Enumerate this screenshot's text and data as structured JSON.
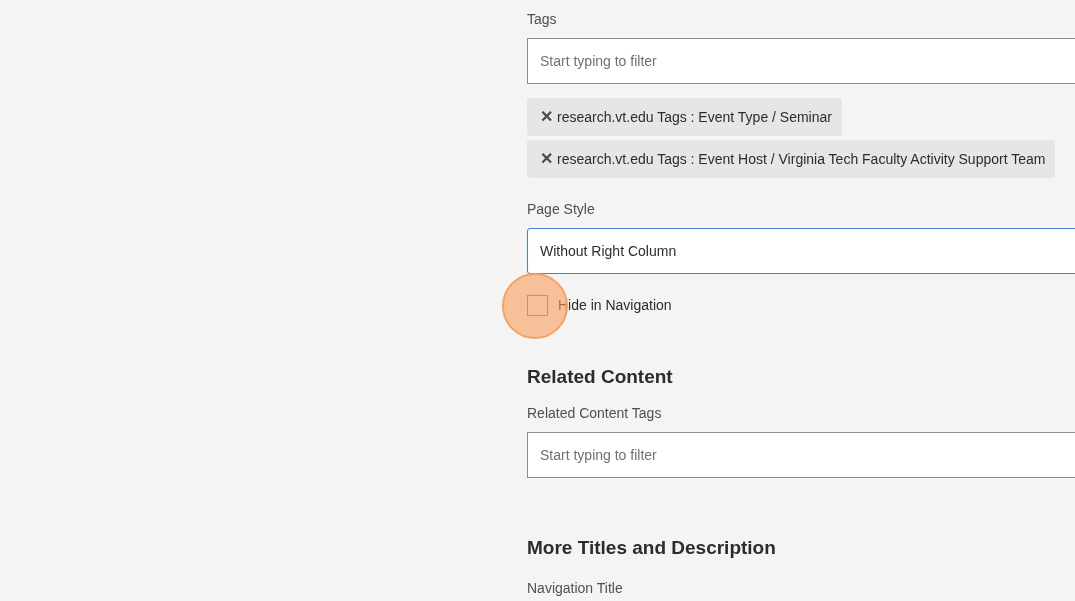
{
  "tags": {
    "label": "Tags",
    "placeholder": "Start typing to filter",
    "chips": [
      {
        "remove": "✕",
        "text": "research.vt.edu Tags : Event Type / Seminar"
      },
      {
        "remove": "✕",
        "text": "research.vt.edu Tags : Event Host / Virginia Tech Faculty Activity Support Team"
      }
    ]
  },
  "page_style": {
    "label": "Page Style",
    "value": "Without Right Column"
  },
  "hide_in_navigation": {
    "label": "Hide in Navigation",
    "checked": false
  },
  "related_content": {
    "heading": "Related Content",
    "tags_label": "Related Content Tags",
    "placeholder": "Start typing to filter"
  },
  "more_titles": {
    "heading": "More Titles and Description",
    "navigation_title_label": "Navigation Title"
  }
}
